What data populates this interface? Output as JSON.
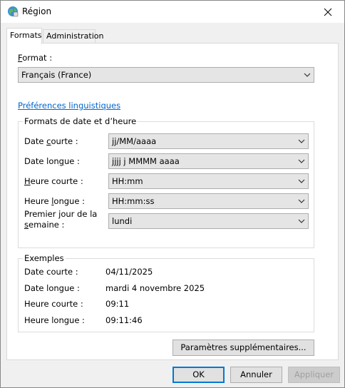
{
  "window": {
    "title": "Région",
    "icon": "globe-icon",
    "close_icon": "close-icon"
  },
  "tabs": [
    {
      "label": "Formats",
      "active": true
    },
    {
      "label": "Administration",
      "active": false
    }
  ],
  "format": {
    "label": "Format :",
    "value": "Français (France)"
  },
  "language_prefs_link": "Préférences linguistiques",
  "date_time_formats": {
    "title": "Formats de date et d’heure",
    "rows": [
      {
        "label": "Date courte :",
        "value": "jj/MM/aaaa"
      },
      {
        "label": "Date longue :",
        "value": "jjjj j MMMM aaaa"
      },
      {
        "label": "Heure courte :",
        "value": "HH:mm"
      },
      {
        "label": "Heure longue :",
        "value": "HH:mm:ss"
      },
      {
        "label_line1": "Premier jour de la",
        "label_line2": "semaine :",
        "value": "lundi"
      }
    ]
  },
  "examples": {
    "title": "Exemples",
    "rows": [
      {
        "label": "Date courte :",
        "value": "04/11/2025"
      },
      {
        "label": "Date longue :",
        "value": "mardi 4 novembre 2025"
      },
      {
        "label": "Heure courte :",
        "value": "09:11"
      },
      {
        "label": "Heure longue :",
        "value": "09:11:46"
      }
    ]
  },
  "additional_settings_button": "Paramètres supplémentaires...",
  "footer": {
    "ok": "OK",
    "cancel": "Annuler",
    "apply": "Appliquer"
  }
}
